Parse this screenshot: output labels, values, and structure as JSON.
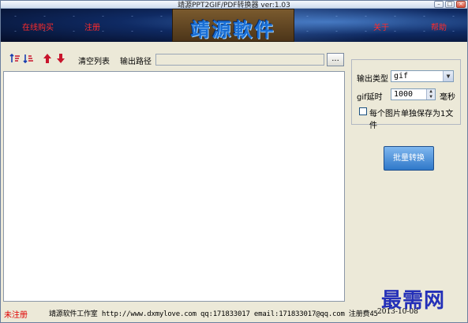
{
  "window": {
    "title": "靖源PPT2GIF/PDF转换器 ver:1.03",
    "buttons": {
      "minimize": "–",
      "maximize": "□",
      "close": "×"
    }
  },
  "banner": {
    "link_buy": "在线购买",
    "link_register": "注册",
    "logo_text": "靖源軟件",
    "link_about": "关于",
    "link_help": "帮助"
  },
  "toolbar": {
    "icons": [
      "move-top-icon",
      "move-bottom-icon",
      "move-up-icon",
      "move-down-icon"
    ],
    "clear_list": "清空列表",
    "output_path_label": "输出路径",
    "output_path_value": "",
    "browse_label": "..."
  },
  "options": {
    "output_type_label": "输出类型",
    "output_type_value": "gif",
    "gif_delay_label": "gif延时",
    "gif_delay_value": "1000",
    "gif_delay_unit": "毫秒",
    "save_each_label": "每个图片单独保存为1文件",
    "save_each_checked": false
  },
  "convert_button": "批量转换",
  "status": {
    "registration": "未注册",
    "info": "靖源软件工作室 http://www.dxmylove.com qq:171833017 email:171833017@qq.com 注册费45",
    "date": "2013-10-08"
  },
  "watermark": "最需网",
  "colors": {
    "status_red": "#e00000",
    "banner_link": "#ff2b2b",
    "convert_button": "#2f78c9",
    "watermark": "#2430b8"
  }
}
